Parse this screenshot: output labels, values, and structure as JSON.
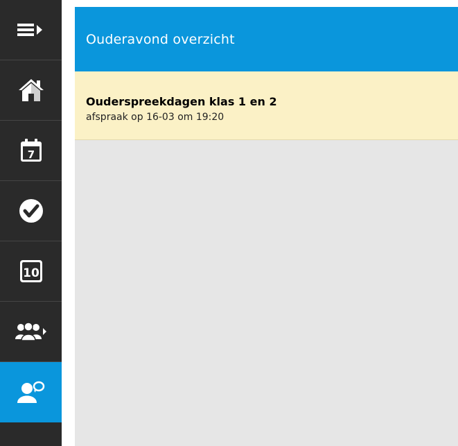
{
  "sidebar": {
    "items": [
      {
        "name": "menu-toggle",
        "icon": "menu-arrow-icon"
      },
      {
        "name": "home",
        "icon": "home-icon"
      },
      {
        "name": "agenda",
        "icon": "calendar-7-icon",
        "label": "7"
      },
      {
        "name": "tasks",
        "icon": "checkmark-icon"
      },
      {
        "name": "grades",
        "icon": "grades-10-icon",
        "label": "10"
      },
      {
        "name": "groups",
        "icon": "people-group-icon"
      },
      {
        "name": "parent-evening",
        "icon": "person-speech-icon",
        "active": true
      }
    ],
    "active_color": "#0a96dc"
  },
  "header": {
    "title": "Ouderavond overzicht"
  },
  "appointments": [
    {
      "title": "Ouderspreekdagen klas 1 en 2",
      "subtitle": "afspraak op 16-03 om 19:20"
    }
  ],
  "colors": {
    "sidebar_bg": "#2a2a2a",
    "header_bg": "#0a96dc",
    "appointment_bg": "#fbf1c6",
    "content_bg": "#e6e6e6"
  }
}
